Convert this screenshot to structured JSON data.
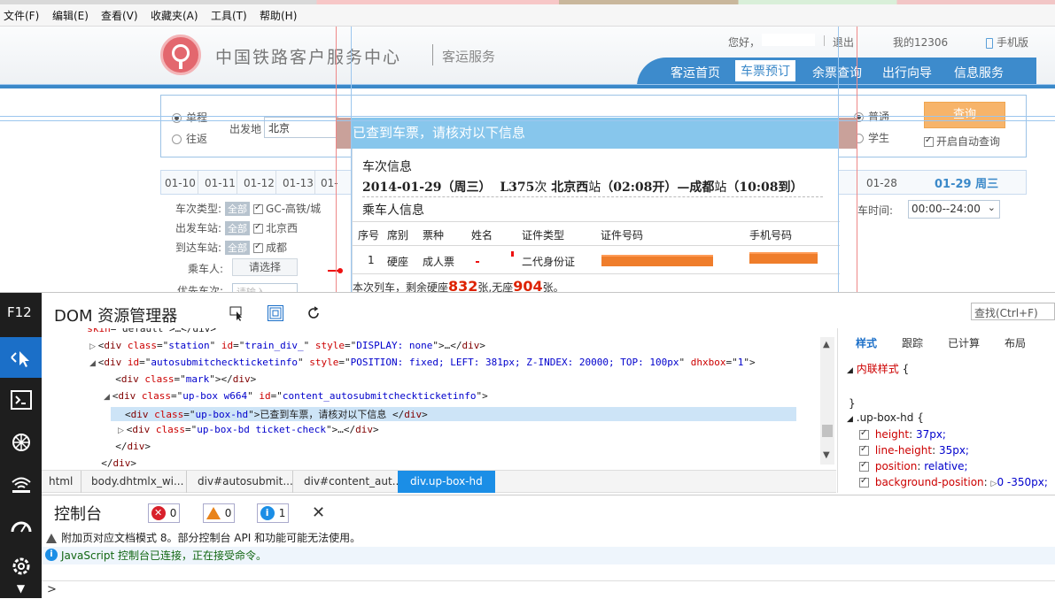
{
  "menubar": {
    "items": [
      "文件(F)",
      "编辑(E)",
      "查看(V)",
      "收藏夹(A)",
      "工具(T)",
      "帮助(H)"
    ]
  },
  "site": {
    "title": "中国铁路客户服务中心",
    "subtitle": "客运服务",
    "greeting": "您好，",
    "logout": "退出",
    "my12306": "我的12306",
    "mobile": "手机版",
    "tabs": [
      "客运首页",
      "车票预订",
      "余票查询",
      "出行向导",
      "信息服务"
    ],
    "active_tab": "车票预订"
  },
  "form": {
    "trip_oneway": "单程",
    "trip_round": "往返",
    "from_label": "出发地",
    "from_value": "北京",
    "ticket_normal": "普通",
    "ticket_student": "学生",
    "query_button": "查询",
    "auto_query": "开启自动查询",
    "dates": [
      "01-10",
      "01-11",
      "01-12",
      "01-13",
      "01-"
    ],
    "dates_right": [
      "01-28"
    ],
    "selected_date": "01-29 周三",
    "depart_time_label": "车时间:",
    "depart_time_value": "00:00--24:00",
    "filter_rows": [
      {
        "label": "车次类型:",
        "tag": "全部",
        "option": "GC-高铁/城"
      },
      {
        "label": "出发车站:",
        "tag": "全部",
        "option": "北京西"
      },
      {
        "label": "到达车站:",
        "tag": "全部",
        "option": "成都"
      }
    ],
    "passenger_label": "乘车人:",
    "passenger_select": "请选择",
    "priority_label": "优先车次:",
    "priority_placeholder": "请输入"
  },
  "dialog": {
    "header": "已查到车票，请核对以下信息",
    "train_section": "车次信息",
    "train_date": "2014-01-29（周三）",
    "train_no": "L375",
    "train_suffix": "次",
    "from_station": "北京西",
    "station_word": "站",
    "depart": "（02:08开）",
    "dash": "—",
    "to_station": "成都",
    "arrive": "（10:08到）",
    "passenger_section": "乘车人信息",
    "columns": [
      "序号",
      "席别",
      "票种",
      "姓名",
      "证件类型",
      "证件号码",
      "手机号码"
    ],
    "row": {
      "no": "1",
      "seat": "硬座",
      "ticket": "成人票",
      "id_type": "二代身份证"
    },
    "remain_prefix": "本次列车，剩余硬座",
    "remain_hard": "832",
    "remain_mid": "张,无座",
    "remain_none": "904",
    "remain_suffix": "张。"
  },
  "devtools": {
    "f12": "F12",
    "title": "DOM 资源管理器",
    "find_placeholder": "查找(Ctrl+F)",
    "dom_lines": [
      {
        "indent": 0,
        "tri": "",
        "parts": [
          [
            "a",
            "skin"
          ],
          [
            "p",
            "=\"default\">…</div>"
          ]
        ]
      },
      {
        "indent": 1,
        "tri": "▷",
        "parts": [
          [
            "p",
            "<"
          ],
          [
            "t",
            "div"
          ],
          [
            "p",
            " "
          ],
          [
            "a",
            "class"
          ],
          [
            "p",
            "=\""
          ],
          [
            "v",
            "station"
          ],
          [
            "p",
            "\" "
          ],
          [
            "a",
            "id"
          ],
          [
            "p",
            "=\""
          ],
          [
            "v",
            "train_div_"
          ],
          [
            "p",
            "\" "
          ],
          [
            "a",
            "style"
          ],
          [
            "p",
            "=\""
          ],
          [
            "v",
            "DISPLAY: none"
          ],
          [
            "p",
            "\">…</"
          ],
          [
            "t",
            "div"
          ],
          [
            "p",
            ">"
          ]
        ]
      },
      {
        "indent": 1,
        "tri": "◢",
        "parts": [
          [
            "p",
            "<"
          ],
          [
            "t",
            "div"
          ],
          [
            "p",
            " "
          ],
          [
            "a",
            "id"
          ],
          [
            "p",
            "=\""
          ],
          [
            "v",
            "autosubmitcheckticketinfo"
          ],
          [
            "p",
            "\" "
          ],
          [
            "a",
            "style"
          ],
          [
            "p",
            "=\""
          ],
          [
            "v",
            "POSITION: fixed; LEFT: 381px; Z-INDEX: 20000; TOP: 100px"
          ],
          [
            "p",
            "\" "
          ],
          [
            "a",
            "dhxbox"
          ],
          [
            "p",
            "=\""
          ],
          [
            "v",
            "1"
          ],
          [
            "p",
            "\">"
          ]
        ]
      },
      {
        "indent": 2,
        "tri": "",
        "parts": [
          [
            "p",
            "<"
          ],
          [
            "t",
            "div"
          ],
          [
            "p",
            " "
          ],
          [
            "a",
            "class"
          ],
          [
            "p",
            "=\""
          ],
          [
            "v",
            "mark"
          ],
          [
            "p",
            "\"></"
          ],
          [
            "t",
            "div"
          ],
          [
            "p",
            ">"
          ]
        ]
      },
      {
        "indent": 2,
        "tri": "◢",
        "parts": [
          [
            "p",
            "<"
          ],
          [
            "t",
            "div"
          ],
          [
            "p",
            " "
          ],
          [
            "a",
            "class"
          ],
          [
            "p",
            "=\""
          ],
          [
            "v",
            "up-box w664"
          ],
          [
            "p",
            "\" "
          ],
          [
            "a",
            "id"
          ],
          [
            "p",
            "=\""
          ],
          [
            "v",
            "content_autosubmitcheckticketinfo"
          ],
          [
            "p",
            "\">"
          ]
        ]
      },
      {
        "indent": 3,
        "tri": "",
        "sel": true,
        "parts": [
          [
            "p",
            "<"
          ],
          [
            "t",
            "div"
          ],
          [
            "p",
            " "
          ],
          [
            "a",
            "class"
          ],
          [
            "p",
            "=\""
          ],
          [
            "v",
            "up-box-hd"
          ],
          [
            "p",
            "\">已查到车票，请核对以下信息 </"
          ],
          [
            "t",
            "div"
          ],
          [
            "p",
            ">"
          ]
        ]
      },
      {
        "indent": 3,
        "tri": "▷",
        "parts": [
          [
            "p",
            "<"
          ],
          [
            "t",
            "div"
          ],
          [
            "p",
            " "
          ],
          [
            "a",
            "class"
          ],
          [
            "p",
            "=\""
          ],
          [
            "v",
            "up-box-bd ticket-check"
          ],
          [
            "p",
            "\">…</"
          ],
          [
            "t",
            "div"
          ],
          [
            "p",
            ">"
          ]
        ]
      },
      {
        "indent": 2,
        "tri": "",
        "parts": [
          [
            "p",
            "</"
          ],
          [
            "t",
            "div"
          ],
          [
            "p",
            ">"
          ]
        ]
      },
      {
        "indent": 1,
        "tri": "",
        "parts": [
          [
            "p",
            "</"
          ],
          [
            "t",
            "div"
          ],
          [
            "p",
            ">"
          ]
        ]
      }
    ],
    "breadcrumbs": [
      "html",
      "body.dhtmlx_wi...",
      "div#autosubmit...",
      "div#content_aut...",
      "div.up-box-hd"
    ],
    "style_tabs": [
      "样式",
      "跟踪",
      "已计算",
      "布局"
    ],
    "inline_style": "内联样式",
    "selector": ".up-box-hd",
    "props": [
      {
        "name": "height",
        "value": "37px;"
      },
      {
        "name": "line-height",
        "value": "35px;"
      },
      {
        "name": "position",
        "value": "relative;"
      },
      {
        "name": "background-position",
        "value": "0 -350px;"
      }
    ],
    "console_title": "控制台",
    "errors": "0",
    "warnings": "0",
    "infos": "1",
    "msg_warning": "附加页对应文档模式 8。部分控制台 API 和功能可能无法使用。",
    "msg_info": "JavaScript 控制台已连接，正在接受命令。",
    "prompt": ">"
  }
}
